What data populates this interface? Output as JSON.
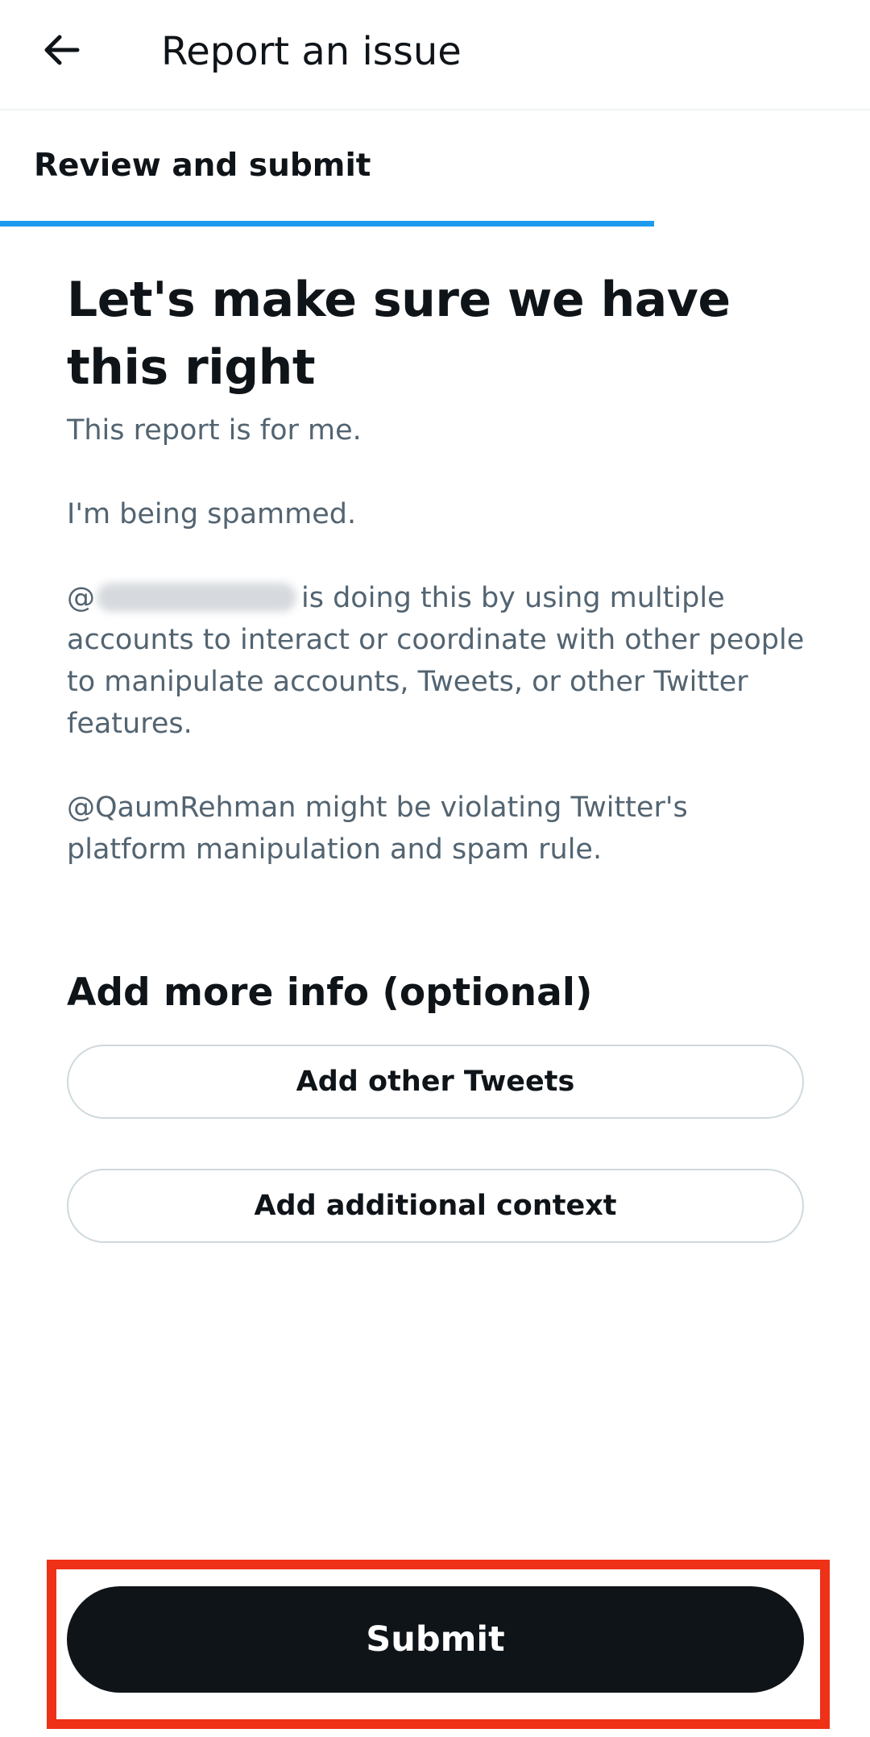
{
  "header": {
    "back_icon": "arrow-left-icon",
    "title": "Report an issue"
  },
  "tabs": [
    {
      "label": "Review and submit",
      "active": true
    }
  ],
  "review": {
    "headline": "Let's make sure we have this right",
    "paragraph_1": "This report is for me.",
    "paragraph_2": "I'm being spammed.",
    "paragraph_3_prefix": "@",
    "paragraph_3_rest": "is doing this by using multiple accounts to interact or coordinate with other people to manipulate accounts, Tweets, or other Twitter features.",
    "paragraph_4": "@QaumRehman might be violating Twitter's platform manipulation and spam rule."
  },
  "more_info": {
    "title": "Add more info (optional)",
    "add_tweets_label": "Add other Tweets",
    "add_context_label": "Add additional context"
  },
  "footer": {
    "submit_label": "Submit"
  },
  "colors": {
    "text_primary": "#0f1419",
    "text_secondary": "#536471",
    "tab_indicator": "#1d9bf0",
    "button_border": "#cfd9de",
    "submit_bg": "#0f1419",
    "highlight": "#ee3117"
  }
}
